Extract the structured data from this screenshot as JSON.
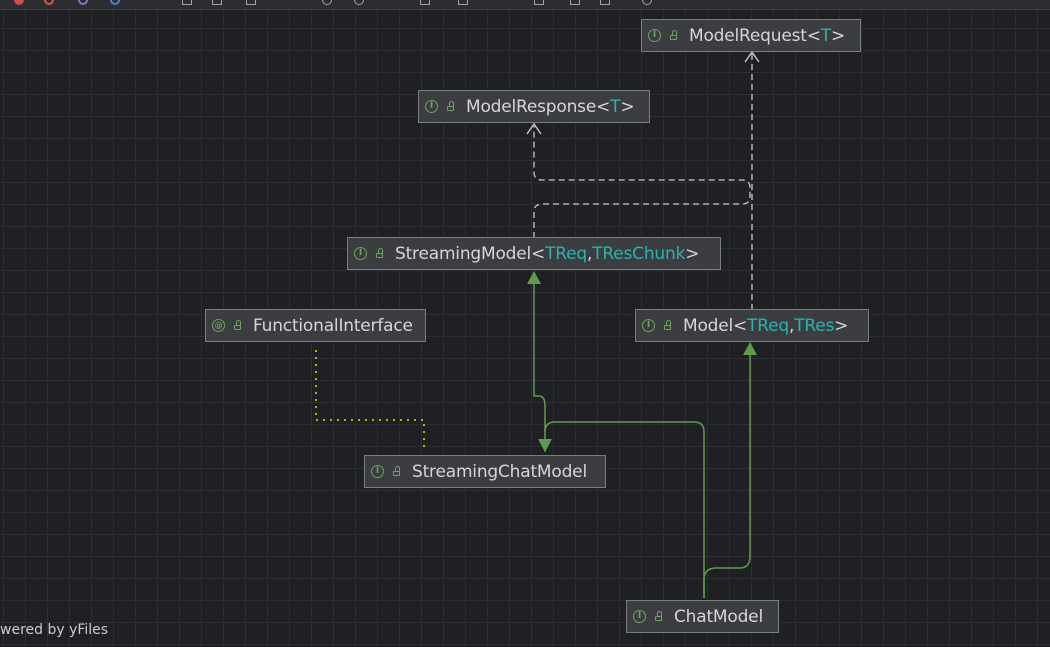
{
  "toolbar": {
    "icons": [
      "red-circle-icon",
      "purple-circle-icon",
      "blue-circle-icon",
      "toolbar-tool-icon"
    ]
  },
  "nodes": {
    "model_request": {
      "kind": "I",
      "name": "ModelRequest",
      "open": "<",
      "params": [
        {
          "p": "T"
        }
      ],
      "close": ">"
    },
    "model_response": {
      "kind": "I",
      "name": "ModelResponse",
      "open": "<",
      "params": [
        {
          "p": "T"
        }
      ],
      "close": ">"
    },
    "streaming_model": {
      "kind": "I",
      "name": "StreamingModel",
      "open": "<",
      "params": [
        {
          "p": "TReq"
        },
        {
          "sep": ", "
        },
        {
          "p": "TResChunk"
        }
      ],
      "close": ">"
    },
    "functional_interface": {
      "kind": "@",
      "name": "FunctionalInterface"
    },
    "model": {
      "kind": "I",
      "name": "Model",
      "open": "<",
      "params": [
        {
          "p": "TReq"
        },
        {
          "sep": ", "
        },
        {
          "p": "TRes"
        }
      ],
      "close": ">"
    },
    "streaming_chat_model": {
      "kind": "I",
      "name": "StreamingChatModel"
    },
    "chat_model": {
      "kind": "I",
      "name": "ChatModel"
    }
  },
  "footer": {
    "text": "wered by yFiles"
  },
  "colors": {
    "background": "#1f2024",
    "node_fill": "#3b3d41",
    "node_border": "#7a7d82",
    "type_param": "#2ab3b0",
    "extends_edge": "#5f9b4f",
    "uses_edge": "#c8c8c8",
    "annotation_edge": "#b5b500"
  }
}
